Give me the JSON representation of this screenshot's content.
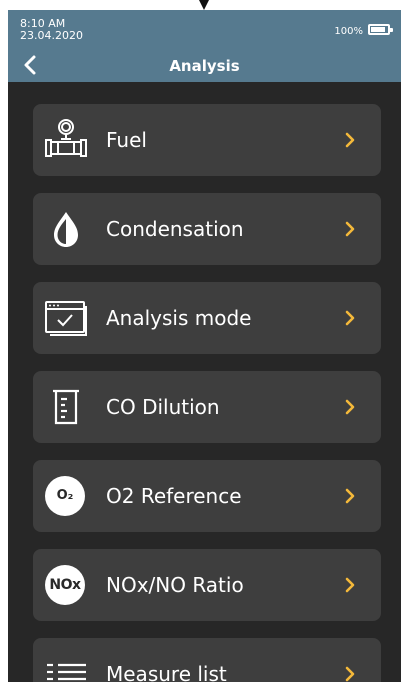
{
  "status_bar": {
    "time": "8:10 AM",
    "date": "23.04.2020",
    "battery_percent": "100%",
    "battery_level": 1.0
  },
  "header": {
    "title": "Analysis",
    "back_icon": "chevron-left-icon"
  },
  "colors": {
    "header_bg": "#567a8f",
    "screen_bg": "#272727",
    "item_bg": "#3e3e3e",
    "chevron": "#f4b93a",
    "text": "#ffffff"
  },
  "menu": {
    "items": [
      {
        "label": "Fuel",
        "icon": "fuel-meter-icon"
      },
      {
        "label": "Condensation",
        "icon": "droplet-icon"
      },
      {
        "label": "Analysis mode",
        "icon": "screen-check-icon"
      },
      {
        "label": "CO Dilution",
        "icon": "beaker-icon"
      },
      {
        "label": "O2 Reference",
        "icon": "o2-badge-icon",
        "badge": "O₂"
      },
      {
        "label": "NOx/NO Ratio",
        "icon": "nox-badge-icon",
        "badge": "NOx"
      },
      {
        "label": "Measure list",
        "icon": "list-icon"
      }
    ]
  }
}
